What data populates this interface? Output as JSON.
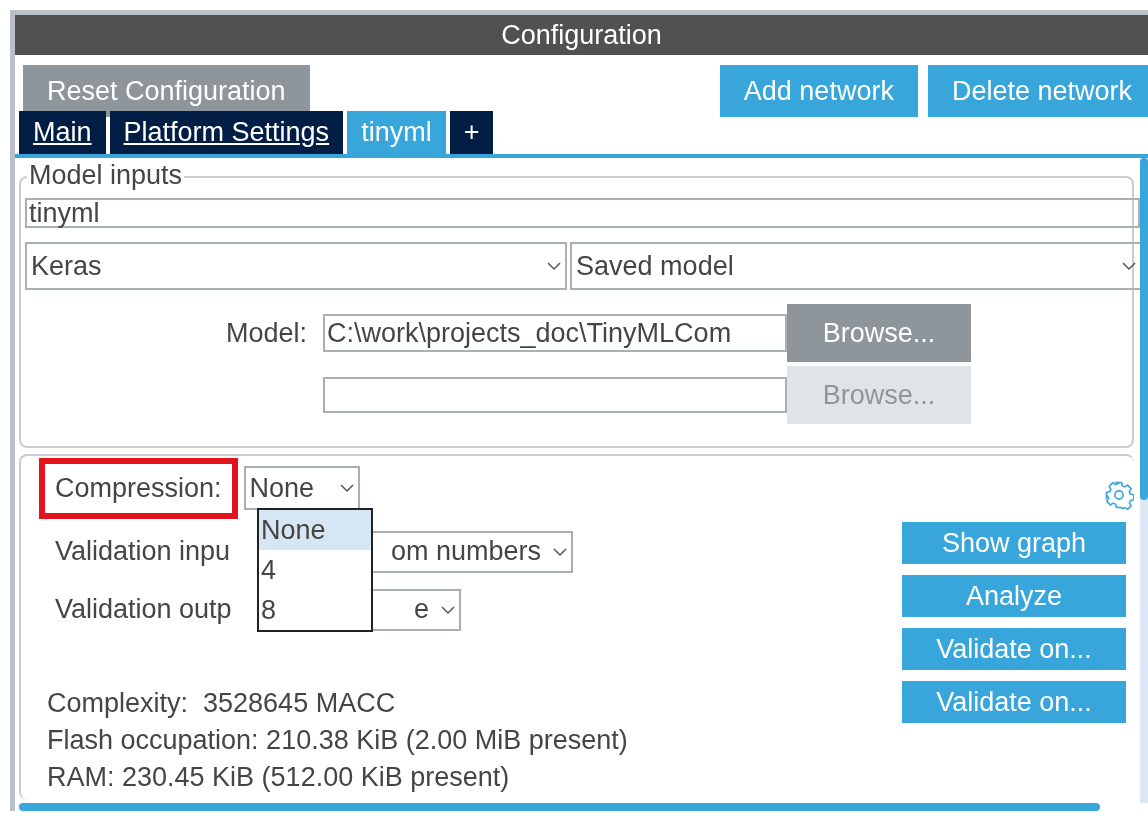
{
  "window": {
    "title": "Configuration"
  },
  "toolbar": [
    {
      "label": "Reset Configuration",
      "kind": "neutral"
    },
    {
      "label": "Add network",
      "kind": "primary"
    },
    {
      "label": "Delete network",
      "kind": "primary"
    }
  ],
  "tabs": [
    {
      "label": "Main",
      "selected": false
    },
    {
      "label": "Platform Settings",
      "selected": false
    },
    {
      "label": "tinyml",
      "selected": true
    },
    {
      "label": "+",
      "selected": false
    }
  ],
  "model_inputs": {
    "title": "Model inputs",
    "name": "tinyml",
    "framework": "Keras",
    "model_format": "Saved model",
    "model_label": "Model:",
    "model_path": "C:\\work\\projects_doc\\TinyMLCom",
    "browse_buttons": [
      {
        "label": "Browse...",
        "disabled": false
      },
      {
        "label": "Browse...",
        "disabled": true
      }
    ]
  },
  "settings": {
    "compression": {
      "label": "Compression:",
      "highlighted": true,
      "value": "None",
      "expanded": true,
      "options": [
        {
          "label": "None",
          "selected": true
        },
        {
          "label": "4",
          "selected": false
        },
        {
          "label": "8",
          "selected": false
        }
      ]
    },
    "validation_inputs": {
      "label": "Validation inpu",
      "value": "om numbers"
    },
    "validation_outputs": {
      "label": "Validation outp",
      "value": "e"
    },
    "actions": [
      "Show graph",
      "Analyze",
      "Validate on...",
      "Validate on..."
    ],
    "stats": [
      "Complexity:  3528645 MACC",
      "Flash occupation: 210.38 KiB (2.00 MiB present)",
      "RAM: 230.45 KiB (512.00 KiB present)"
    ]
  }
}
